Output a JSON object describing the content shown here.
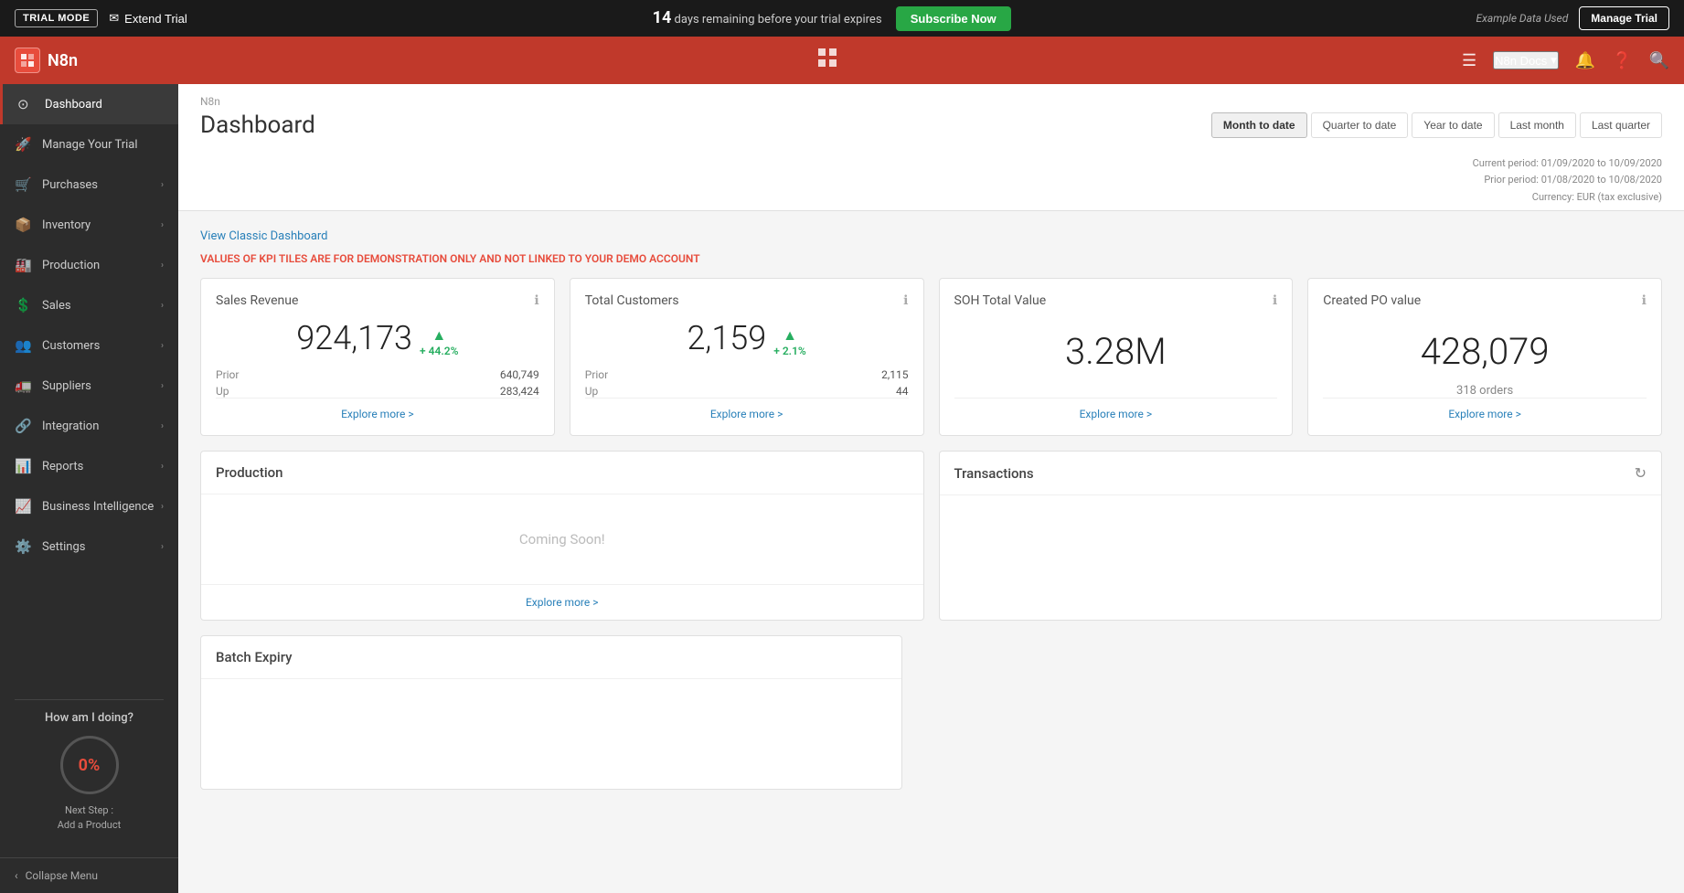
{
  "trial_bar": {
    "mode_label": "TRIAL MODE",
    "extend_label": "Extend Trial",
    "days_remaining": "14",
    "trial_message": " days remaining before your trial expires",
    "subscribe_label": "Subscribe Now",
    "example_data_label": "Example Data Used",
    "manage_trial_label": "Manage Trial"
  },
  "top_nav": {
    "logo_text": "N8n",
    "docs_label": "N8n Docs"
  },
  "sidebar": {
    "items": [
      {
        "label": "Dashboard",
        "icon": "⊙",
        "active": true,
        "has_chevron": false
      },
      {
        "label": "Manage Your Trial",
        "icon": "🚀",
        "active": false,
        "has_chevron": false
      },
      {
        "label": "Purchases",
        "icon": "🛒",
        "active": false,
        "has_chevron": true
      },
      {
        "label": "Inventory",
        "icon": "📦",
        "active": false,
        "has_chevron": true
      },
      {
        "label": "Production",
        "icon": "🏭",
        "active": false,
        "has_chevron": true
      },
      {
        "label": "Sales",
        "icon": "💲",
        "active": false,
        "has_chevron": true
      },
      {
        "label": "Customers",
        "icon": "👥",
        "active": false,
        "has_chevron": true
      },
      {
        "label": "Suppliers",
        "icon": "🚛",
        "active": false,
        "has_chevron": true
      },
      {
        "label": "Integration",
        "icon": "🔗",
        "active": false,
        "has_chevron": true
      },
      {
        "label": "Reports",
        "icon": "📊",
        "active": false,
        "has_chevron": true
      },
      {
        "label": "Business Intelligence",
        "icon": "📈",
        "active": false,
        "has_chevron": true
      },
      {
        "label": "Settings",
        "icon": "⚙️",
        "active": false,
        "has_chevron": true
      }
    ],
    "how_doing_title": "How am I doing?",
    "progress_pct": "0%",
    "next_step_label": "Next Step :",
    "next_step_value": "Add a Product",
    "collapse_label": "Collapse Menu"
  },
  "page_header": {
    "breadcrumb": "N8n",
    "title": "Dashboard",
    "current_period": "Current period: 01/09/2020 to 10/09/2020",
    "prior_period": "Prior period: 01/08/2020 to 10/08/2020",
    "currency": "Currency: EUR (tax exclusive)",
    "date_filters": [
      {
        "label": "Month to date",
        "active": true
      },
      {
        "label": "Quarter to date",
        "active": false
      },
      {
        "label": "Year to date",
        "active": false
      },
      {
        "label": "Last month",
        "active": false
      },
      {
        "label": "Last quarter",
        "active": false
      }
    ]
  },
  "content": {
    "classic_dashboard_link": "View Classic Dashboard",
    "demo_warning": "VALUES OF KPI TILES ARE FOR DEMONSTRATION ONLY AND NOT LINKED TO YOUR DEMO ACCOUNT",
    "kpi_tiles": [
      {
        "title": "Sales Revenue",
        "main_value": "924,173",
        "change_pct": "+ 44.2%",
        "prior_label": "Prior",
        "prior_value": "640,749",
        "up_label": "Up",
        "up_value": "283,424",
        "explore_label": "Explore more >"
      },
      {
        "title": "Total Customers",
        "main_value": "2,159",
        "change_pct": "+ 2.1%",
        "prior_label": "Prior",
        "prior_value": "2,115",
        "up_label": "Up",
        "up_value": "44",
        "explore_label": "Explore more >"
      },
      {
        "title": "SOH Total Value",
        "main_value": "3.28M",
        "explore_label": "Explore more >"
      },
      {
        "title": "Created PO value",
        "main_value": "428,079",
        "subtext": "318 orders",
        "explore_label": "Explore more >"
      }
    ],
    "production_card": {
      "title": "Production",
      "coming_soon": "Coming Soon!",
      "explore_label": "Explore more >"
    },
    "transactions_card": {
      "title": "Transactions"
    },
    "batch_expiry_card": {
      "title": "Batch Expiry"
    }
  }
}
